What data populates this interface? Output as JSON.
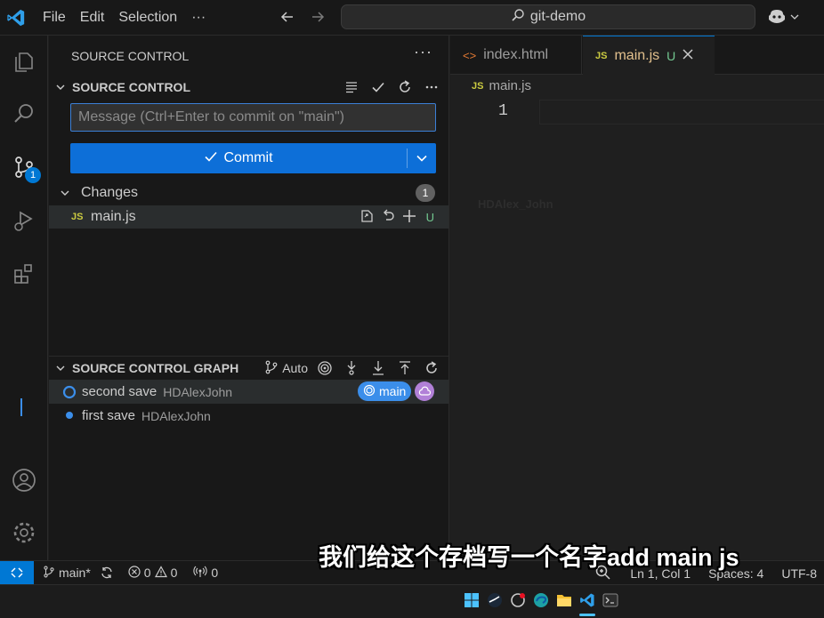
{
  "titlebar": {
    "menu": [
      "File",
      "Edit",
      "Selection",
      "···"
    ],
    "search": "git-demo"
  },
  "activity": {
    "scm_badge": "1"
  },
  "sidebar": {
    "title": "SOURCE CONTROL",
    "more": "···",
    "scm_section": "SOURCE CONTROL",
    "message_placeholder": "Message (Ctrl+Enter to commit on \"main\")",
    "commit_label": "Commit",
    "changes_label": "Changes",
    "changes_count": "1",
    "file": {
      "lang": "JS",
      "name": "main.js",
      "status": "U"
    },
    "graph": {
      "title": "SOURCE CONTROL GRAPH",
      "auto_label": "Auto",
      "commits": [
        {
          "message": "second save",
          "author": "HDAlexJohn",
          "branch": "main"
        },
        {
          "message": "first save",
          "author": "HDAlexJohn"
        }
      ]
    }
  },
  "editor": {
    "tabs": [
      {
        "name": "index.html",
        "icon": "<>"
      },
      {
        "name": "main.js",
        "lang": "JS",
        "status": "U"
      }
    ],
    "breadcrumb": {
      "lang": "JS",
      "file": "main.js"
    },
    "line_number": "1",
    "watermark": "HDAlex_John"
  },
  "statusbar": {
    "branch": "main*",
    "errors": "0",
    "warnings": "0",
    "ports": "0",
    "position": "Ln 1, Col 1",
    "spaces": "Spaces: 4",
    "encoding": "UTF-8"
  },
  "subtitle": "我们给这个存档写一个名字add main js",
  "colors": {
    "accent": "#0078d4",
    "button": "#0d6fd8",
    "untracked": "#73c991",
    "js": "#cbcb41",
    "branch_pill": "#3b8eea",
    "cloud_pill": "#b180d7"
  }
}
